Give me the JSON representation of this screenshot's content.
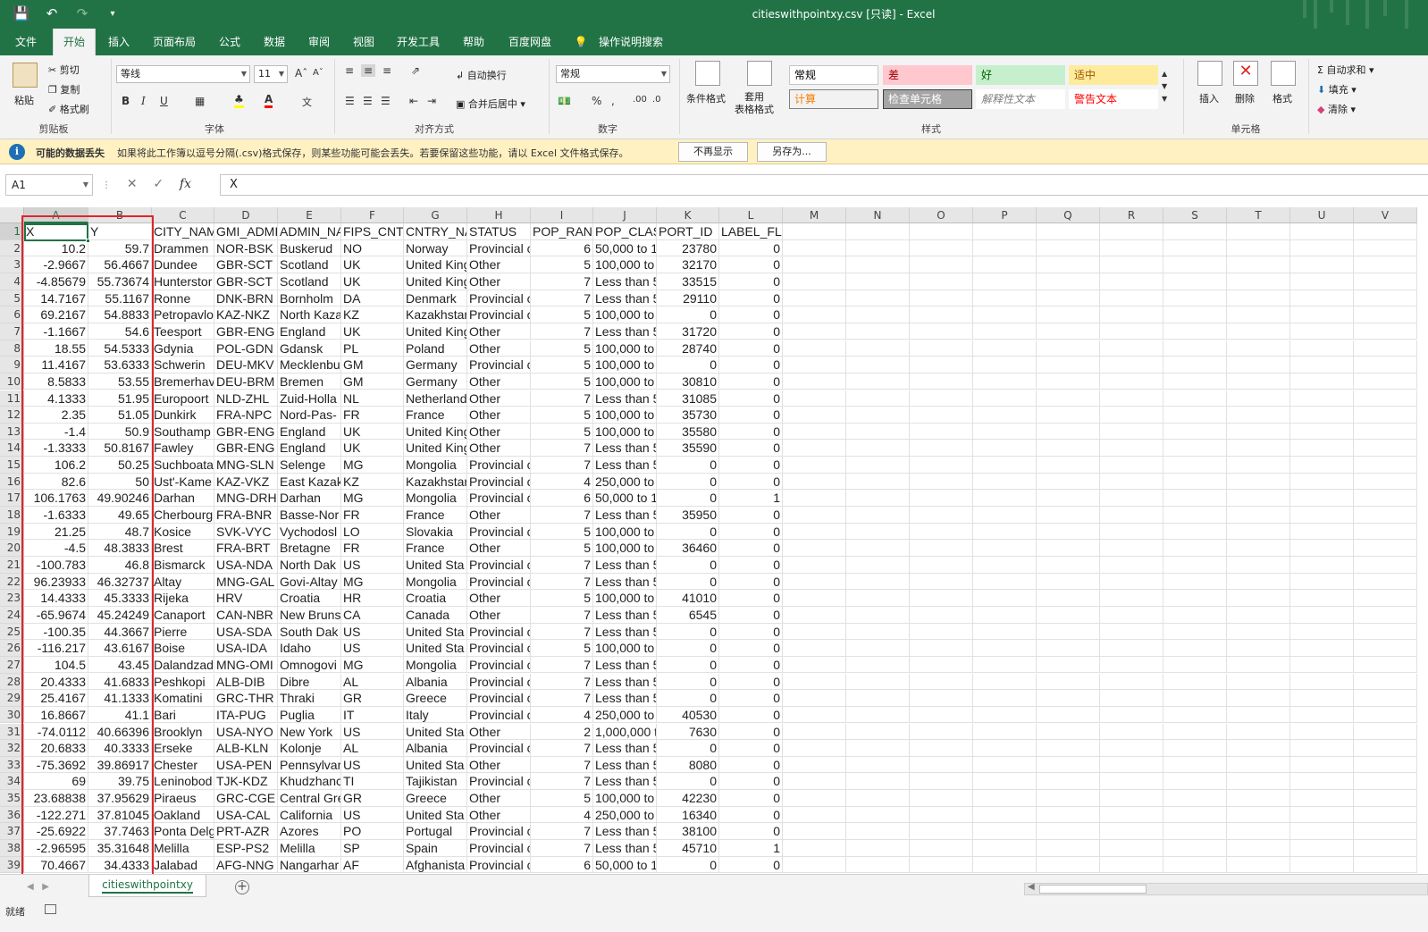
{
  "app": {
    "doc_title": "citieswithpointxy.csv  [只读]  -  Excel"
  },
  "qat": {
    "save_icon": "save-icon",
    "undo_icon": "undo-icon",
    "redo_icon": "redo-icon",
    "customize_icon": "qat-customize-icon"
  },
  "tabs": [
    "文件",
    "开始",
    "插入",
    "页面布局",
    "公式",
    "数据",
    "审阅",
    "视图",
    "开发工具",
    "帮助",
    "百度网盘",
    "操作说明搜索"
  ],
  "ribbon": {
    "clipboard": {
      "paste": "粘贴",
      "cut": "剪切",
      "copy": "复制",
      "format_painter": "格式刷",
      "label": "剪贴板"
    },
    "font": {
      "name": "等线",
      "size": "11",
      "label": "字体",
      "bold": "B",
      "italic": "I",
      "underline": "U"
    },
    "alignment": {
      "wrap": "自动换行",
      "merge": "合并后居中",
      "label": "对齐方式"
    },
    "number": {
      "format": "常规",
      "label": "数字"
    },
    "styles": {
      "conditional": "条件格式",
      "table_fmt": "套用\n表格格式",
      "label": "样式",
      "cells": [
        {
          "text": "常规",
          "bg": "#ffffff",
          "fg": "#000000",
          "border": "#c6c6c6"
        },
        {
          "text": "差",
          "bg": "#ffc7ce",
          "fg": "#9c0006",
          "border": "#ffc7ce"
        },
        {
          "text": "好",
          "bg": "#c6efce",
          "fg": "#006100",
          "border": "#c6efce"
        },
        {
          "text": "适中",
          "bg": "#ffeb9c",
          "fg": "#9c5700",
          "border": "#ffeb9c"
        },
        {
          "text": "计算",
          "bg": "#f2f2f2",
          "fg": "#fa7d00",
          "border": "#7f7f7f"
        },
        {
          "text": "检查单元格",
          "bg": "#a5a5a5",
          "fg": "#ffffff",
          "border": "#3f3f3f"
        },
        {
          "text": "解释性文本",
          "bg": "#ffffff",
          "fg": "#7f7f7f",
          "border": "#ffffff"
        },
        {
          "text": "警告文本",
          "bg": "#ffffff",
          "fg": "#ff0000",
          "border": "#ffffff"
        }
      ]
    },
    "cells": {
      "insert": "插入",
      "delete": "删除",
      "format": "格式",
      "label": "单元格"
    },
    "editing": {
      "autosum": "自动求和",
      "fill": "填充",
      "clear": "清除"
    }
  },
  "infobar": {
    "title": "可能的数据丢失",
    "message": "如果将此工作簿以逗号分隔(.csv)格式保存，则某些功能可能会丢失。若要保留这些功能，请以 Excel 文件格式保存。",
    "btn_dont_show": "不再显示",
    "btn_save_as": "另存为..."
  },
  "formula_bar": {
    "name_box": "A1",
    "formula": "X"
  },
  "columns": [
    "A",
    "B",
    "C",
    "D",
    "E",
    "F",
    "G",
    "H",
    "I",
    "J",
    "K",
    "L",
    "M",
    "N",
    "O",
    "P",
    "Q",
    "R",
    "S",
    "T",
    "U",
    "V"
  ],
  "rows": [
    [
      "X",
      "Y",
      "CITY_NAM",
      "GMI_ADMI",
      "ADMIN_NA",
      "FIPS_CNTR",
      "CNTRY_NA",
      "STATUS",
      "POP_RANK",
      "POP_CLASS",
      "PORT_ID",
      "LABEL_FLAG"
    ],
    [
      "10.2",
      "59.7",
      "Drammen",
      "NOR-BSK",
      "Buskerud",
      "NO",
      "Norway",
      "Provincial c",
      "6",
      "50,000 to 1",
      "23780",
      "0"
    ],
    [
      "-2.9667",
      "56.4667",
      "Dundee",
      "GBR-SCT",
      "Scotland",
      "UK",
      "United King",
      "Other",
      "5",
      "100,000 to",
      "32170",
      "0"
    ],
    [
      "-4.85679",
      "55.73674",
      "Hunterstor",
      "GBR-SCT",
      "Scotland",
      "UK",
      "United King",
      "Other",
      "7",
      "Less than 5",
      "33515",
      "0"
    ],
    [
      "14.7167",
      "55.1167",
      "Ronne",
      "DNK-BRN",
      "Bornholm",
      "DA",
      "Denmark",
      "Provincial c",
      "7",
      "Less than 5",
      "29110",
      "0"
    ],
    [
      "69.2167",
      "54.8833",
      "Petropavlo",
      "KAZ-NKZ",
      "North Kaza",
      "KZ",
      "Kazakhstar",
      "Provincial c",
      "5",
      "100,000 to",
      "0",
      "0"
    ],
    [
      "-1.1667",
      "54.6",
      "Teesport",
      "GBR-ENG",
      "England",
      "UK",
      "United King",
      "Other",
      "7",
      "Less than 5",
      "31720",
      "0"
    ],
    [
      "18.55",
      "54.5333",
      "Gdynia",
      "POL-GDN",
      "Gdansk",
      "PL",
      "Poland",
      "Other",
      "5",
      "100,000 to",
      "28740",
      "0"
    ],
    [
      "11.4167",
      "53.6333",
      "Schwerin",
      "DEU-MKV",
      "Mecklenbu",
      "GM",
      "Germany",
      "Provincial c",
      "5",
      "100,000 to",
      "0",
      "0"
    ],
    [
      "8.5833",
      "53.55",
      "Bremerhav",
      "DEU-BRM",
      "Bremen",
      "GM",
      "Germany",
      "Other",
      "5",
      "100,000 to",
      "30810",
      "0"
    ],
    [
      "4.1333",
      "51.95",
      "Europoort",
      "NLD-ZHL",
      "Zuid-Holla",
      "NL",
      "Netherland",
      "Other",
      "7",
      "Less than 5",
      "31085",
      "0"
    ],
    [
      "2.35",
      "51.05",
      "Dunkirk",
      "FRA-NPC",
      "Nord-Pas-",
      "FR",
      "France",
      "Other",
      "5",
      "100,000 to",
      "35730",
      "0"
    ],
    [
      "-1.4",
      "50.9",
      "Southamp",
      "GBR-ENG",
      "England",
      "UK",
      "United King",
      "Other",
      "5",
      "100,000 to",
      "35580",
      "0"
    ],
    [
      "-1.3333",
      "50.8167",
      "Fawley",
      "GBR-ENG",
      "England",
      "UK",
      "United King",
      "Other",
      "7",
      "Less than 5",
      "35590",
      "0"
    ],
    [
      "106.2",
      "50.25",
      "Suchboata",
      "MNG-SLN",
      "Selenge",
      "MG",
      "Mongolia",
      "Provincial c",
      "7",
      "Less than 5",
      "0",
      "0"
    ],
    [
      "82.6",
      "50",
      "Ust'-Kame",
      "KAZ-VKZ",
      "East Kazak",
      "KZ",
      "Kazakhstar",
      "Provincial c",
      "4",
      "250,000 to",
      "0",
      "0"
    ],
    [
      "106.1763",
      "49.90246",
      "Darhan",
      "MNG-DRH",
      "Darhan",
      "MG",
      "Mongolia",
      "Provincial c",
      "6",
      "50,000 to 1",
      "0",
      "1"
    ],
    [
      "-1.6333",
      "49.65",
      "Cherbourg",
      "FRA-BNR",
      "Basse-Nor",
      "FR",
      "France",
      "Other",
      "7",
      "Less than 5",
      "35950",
      "0"
    ],
    [
      "21.25",
      "48.7",
      "Kosice",
      "SVK-VYC",
      "Vychodosl",
      "LO",
      "Slovakia",
      "Provincial c",
      "5",
      "100,000 to",
      "0",
      "0"
    ],
    [
      "-4.5",
      "48.3833",
      "Brest",
      "FRA-BRT",
      "Bretagne",
      "FR",
      "France",
      "Other",
      "5",
      "100,000 to",
      "36460",
      "0"
    ],
    [
      "-100.783",
      "46.8",
      "Bismarck",
      "USA-NDA",
      "North Dak",
      "US",
      "United Sta",
      "Provincial c",
      "7",
      "Less than 5",
      "0",
      "0"
    ],
    [
      "96.23933",
      "46.32737",
      "Altay",
      "MNG-GAL",
      "Govi-Altay",
      "MG",
      "Mongolia",
      "Provincial c",
      "7",
      "Less than 5",
      "0",
      "0"
    ],
    [
      "14.4333",
      "45.3333",
      "Rijeka",
      "HRV",
      "Croatia",
      "HR",
      "Croatia",
      "Other",
      "5",
      "100,000 to",
      "41010",
      "0"
    ],
    [
      "-65.9674",
      "45.24249",
      "Canaport",
      "CAN-NBR",
      "New Bruns",
      "CA",
      "Canada",
      "Other",
      "7",
      "Less than 5",
      "6545",
      "0"
    ],
    [
      "-100.35",
      "44.3667",
      "Pierre",
      "USA-SDA",
      "South Dak",
      "US",
      "United Sta",
      "Provincial c",
      "7",
      "Less than 5",
      "0",
      "0"
    ],
    [
      "-116.217",
      "43.6167",
      "Boise",
      "USA-IDA",
      "Idaho",
      "US",
      "United Sta",
      "Provincial c",
      "5",
      "100,000 to",
      "0",
      "0"
    ],
    [
      "104.5",
      "43.45",
      "Dalandzad",
      "MNG-OMI",
      "Omnogovi",
      "MG",
      "Mongolia",
      "Provincial c",
      "7",
      "Less than 5",
      "0",
      "0"
    ],
    [
      "20.4333",
      "41.6833",
      "Peshkopi",
      "ALB-DIB",
      "Dibre",
      "AL",
      "Albania",
      "Provincial c",
      "7",
      "Less than 5",
      "0",
      "0"
    ],
    [
      "25.4167",
      "41.1333",
      "Komatini",
      "GRC-THR",
      "Thraki",
      "GR",
      "Greece",
      "Provincial c",
      "7",
      "Less than 5",
      "0",
      "0"
    ],
    [
      "16.8667",
      "41.1",
      "Bari",
      "ITA-PUG",
      "Puglia",
      "IT",
      "Italy",
      "Provincial c",
      "4",
      "250,000 to",
      "40530",
      "0"
    ],
    [
      "-74.0112",
      "40.66396",
      "Brooklyn",
      "USA-NYO",
      "New York",
      "US",
      "United Sta",
      "Other",
      "2",
      "1,000,000 t",
      "7630",
      "0"
    ],
    [
      "20.6833",
      "40.3333",
      "Erseke",
      "ALB-KLN",
      "Kolonje",
      "AL",
      "Albania",
      "Provincial c",
      "7",
      "Less than 5",
      "0",
      "0"
    ],
    [
      "-75.3692",
      "39.86917",
      "Chester",
      "USA-PEN",
      "Pennsylvar",
      "US",
      "United Sta",
      "Other",
      "7",
      "Less than 5",
      "8080",
      "0"
    ],
    [
      "69",
      "39.75",
      "Leninobod",
      "TJK-KDZ",
      "Khudzhanc",
      "TI",
      "Tajikistan",
      "Provincial c",
      "7",
      "Less than 5",
      "0",
      "0"
    ],
    [
      "23.68838",
      "37.95629",
      "Piraeus",
      "GRC-CGE",
      "Central Gre",
      "GR",
      "Greece",
      "Other",
      "5",
      "100,000 to",
      "42230",
      "0"
    ],
    [
      "-122.271",
      "37.81045",
      "Oakland",
      "USA-CAL",
      "California",
      "US",
      "United Sta",
      "Other",
      "4",
      "250,000 to",
      "16340",
      "0"
    ],
    [
      "-25.6922",
      "37.7463",
      "Ponta Delg",
      "PRT-AZR",
      "Azores",
      "PO",
      "Portugal",
      "Provincial c",
      "7",
      "Less than 5",
      "38100",
      "0"
    ],
    [
      "-2.96595",
      "35.31648",
      "Melilla",
      "ESP-PS2",
      "Melilla",
      "SP",
      "Spain",
      "Provincial c",
      "7",
      "Less than 5",
      "45710",
      "1"
    ],
    [
      "70.4667",
      "34.4333",
      "Jalabad",
      "AFG-NNG",
      "Nangarhar",
      "AF",
      "Afghanista",
      "Provincial c",
      "6",
      "50,000 to 1",
      "0",
      "0"
    ]
  ],
  "sheet_tab": "citieswithpointxy",
  "status": {
    "ready": "就绪"
  }
}
